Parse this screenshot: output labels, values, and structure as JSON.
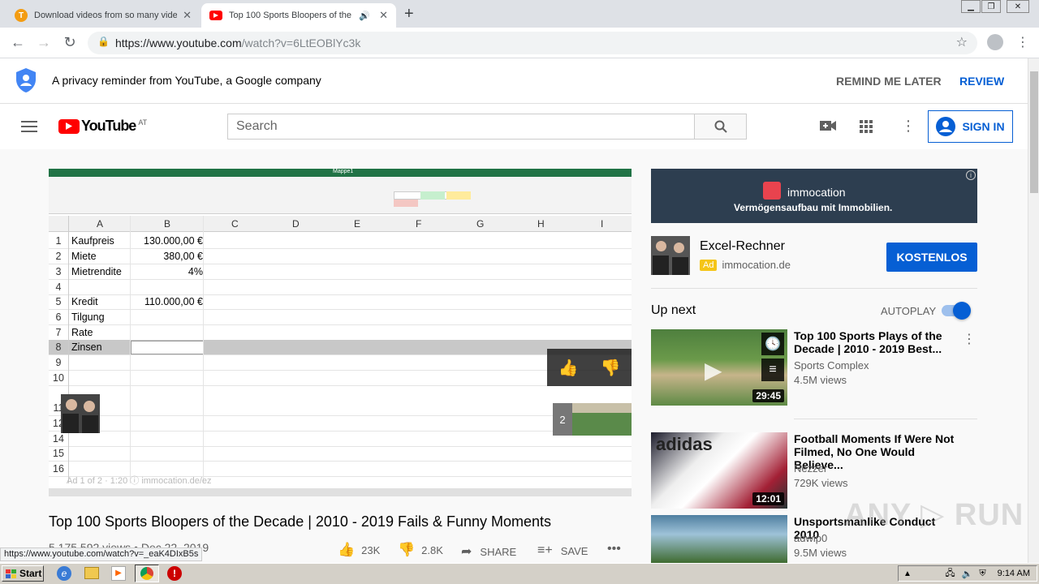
{
  "browser": {
    "tabs": [
      {
        "title": "Download videos from so many video",
        "favicon": "T"
      },
      {
        "title": "Top 100 Sports Bloopers of the",
        "favicon": "yt"
      }
    ],
    "url_host": "https://www.youtube.com",
    "url_path": "/watch?v=6LtEOBlYc3k",
    "status_url": "https://www.youtube.com/watch?v=_eaK4DIxB5s"
  },
  "privacy": {
    "text": "A privacy reminder from YouTube, a Google company",
    "remind_label": "REMIND ME LATER",
    "review_label": "REVIEW"
  },
  "masthead": {
    "logo_text": "YouTube",
    "region": "AT",
    "search_placeholder": "Search",
    "signin_label": "SIGN IN"
  },
  "video": {
    "title": "Top 100 Sports Bloopers of the Decade | 2010 - 2019 Fails & Funny Moments",
    "views_date": "5,175,592 views • Dec 22, 2019",
    "likes": "23K",
    "dislikes": "2.8K",
    "share_label": "SHARE",
    "save_label": "SAVE",
    "ad_overlay": "Ad 1 of 2 · 1:20 ⓘ  immocation.de/ez",
    "next_count": "2",
    "excel": {
      "title": "Mappe1",
      "columns": [
        "A",
        "B",
        "C",
        "D",
        "E",
        "F",
        "G",
        "H",
        "I"
      ],
      "rows": [
        {
          "n": "1",
          "a": "Kaufpreis",
          "b": "130.000,00 €"
        },
        {
          "n": "2",
          "a": "Miete",
          "b": "380,00 €"
        },
        {
          "n": "3",
          "a": "Mietrendite",
          "b": "4%"
        },
        {
          "n": "4",
          "a": "",
          "b": ""
        },
        {
          "n": "5",
          "a": "Kredit",
          "b": "110.000,00 €"
        },
        {
          "n": "6",
          "a": "Tilgung",
          "b": ""
        },
        {
          "n": "7",
          "a": "Rate",
          "b": ""
        },
        {
          "n": "8",
          "a": "Zinsen",
          "b": ""
        },
        {
          "n": "9",
          "a": "",
          "b": ""
        },
        {
          "n": "10",
          "a": "",
          "b": ""
        },
        {
          "n": "11",
          "a": "",
          "b": ""
        },
        {
          "n": "12",
          "a": "",
          "b": ""
        },
        {
          "n": "14",
          "a": "",
          "b": ""
        },
        {
          "n": "15",
          "a": "",
          "b": ""
        },
        {
          "n": "16",
          "a": "",
          "b": ""
        }
      ]
    }
  },
  "ad": {
    "banner_brand": "immocation",
    "banner_tagline": "Vermögensaufbau mit Immobilien.",
    "title": "Excel-Rechner",
    "badge": "Ad",
    "domain": "immocation.de",
    "cta": "KOSTENLOS"
  },
  "upnext": {
    "heading": "Up next",
    "autoplay_label": "AUTOPLAY",
    "autoplay_on": true,
    "items": [
      {
        "title": "Top 100 Sports Plays of the Decade | 2010 - 2019 Best...",
        "channel": "Sports Complex",
        "views": "4.5M views",
        "duration": "29:45"
      },
      {
        "title": "Football Moments If Were Not Filmed, No One Would Believe...",
        "channel": "Nezzer",
        "views": "729K views",
        "duration": "12:01"
      },
      {
        "title": "Unsportsmanlike Conduct 2010",
        "channel": "adwip0",
        "views": "9.5M views",
        "duration": ""
      }
    ]
  },
  "taskbar": {
    "start_label": "Start",
    "clock": "9:14 AM"
  },
  "colors": {
    "accent_blue": "#065fd4",
    "youtube_red": "#ff0000",
    "ad_badge": "#f5c518"
  }
}
